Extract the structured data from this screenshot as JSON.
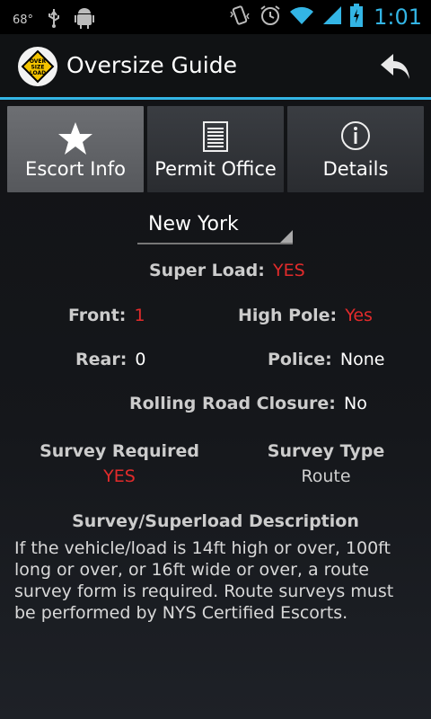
{
  "status_bar": {
    "temperature": "68°",
    "time": "1:01",
    "icons": [
      "usb-icon",
      "android-debug-icon",
      "vibrate-icon",
      "alarm-icon",
      "wifi-icon",
      "signal-icon",
      "battery-charging-icon"
    ]
  },
  "action_bar": {
    "title": "Oversize Guide",
    "logo_text_lines": [
      "OVER",
      "SIZE",
      "LOAD"
    ],
    "back_icon": "back-arrow-icon"
  },
  "tabs": [
    {
      "label": "Escort Info",
      "icon": "star-icon",
      "active": true
    },
    {
      "label": "Permit Office",
      "icon": "document-icon",
      "active": false
    },
    {
      "label": "Details",
      "icon": "info-icon",
      "active": false
    }
  ],
  "state_select": {
    "value": "New York"
  },
  "super_load": {
    "label": "Super Load:",
    "value": "YES"
  },
  "escorts": {
    "front": {
      "label": "Front:",
      "value": "1"
    },
    "high_pole": {
      "label": "High Pole:",
      "value": "Yes"
    },
    "rear": {
      "label": "Rear:",
      "value": "0"
    },
    "police": {
      "label": "Police:",
      "value": "None"
    },
    "rolling_closure": {
      "label": "Rolling Road Closure:",
      "value": "No"
    }
  },
  "survey": {
    "required_label": "Survey Required",
    "required_value": "YES",
    "type_label": "Survey Type",
    "type_value": "Route"
  },
  "description": {
    "title": "Survey/Superload Description",
    "text": "If the vehicle/load is 14ft high or over, 100ft long or over, or 16ft wide or over, a route survey form is required. Route surveys must be performed by NYS Certified Escorts."
  },
  "colors": {
    "accent": "#33b5e5",
    "alert": "#e22b2b"
  }
}
